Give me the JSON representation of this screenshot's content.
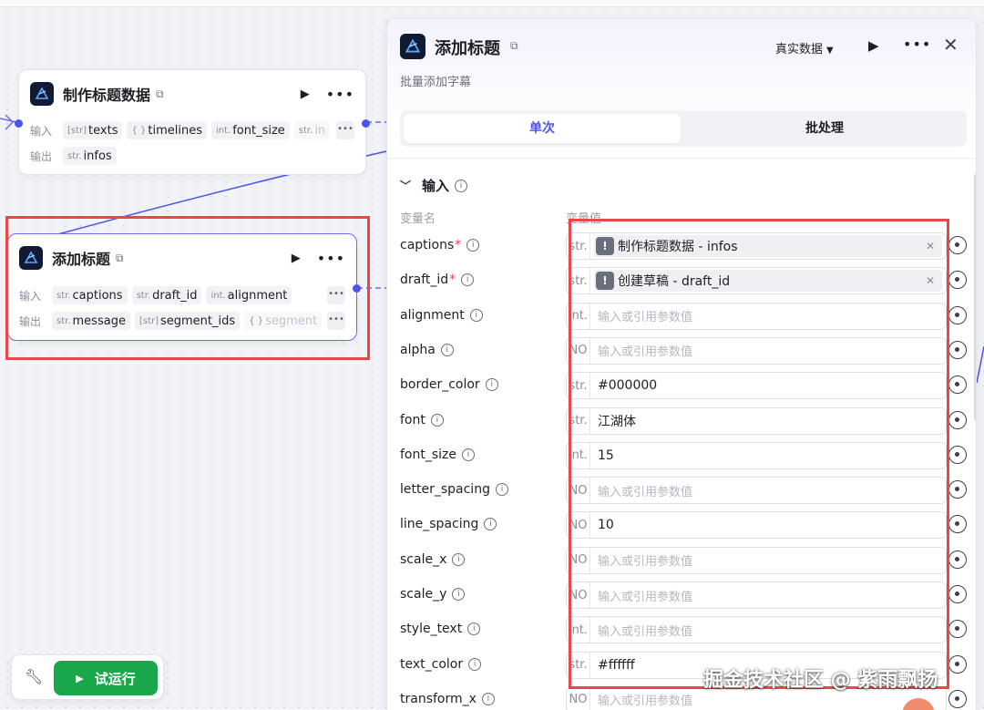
{
  "colors": {
    "accent": "#4d53e8",
    "run_green": "#1aa64a",
    "highlight_red": "#e84848"
  },
  "nodes": {
    "make_title": {
      "title": "制作标题数据",
      "input_label": "输入",
      "output_label": "输出",
      "inputs": [
        {
          "type": "[str]",
          "name": "texts"
        },
        {
          "type": "{ }",
          "name": "timelines"
        },
        {
          "type": "int.",
          "name": "font_size"
        },
        {
          "type": "str.",
          "name": "in"
        }
      ],
      "outputs": [
        {
          "type": "str.",
          "name": "infos"
        }
      ]
    },
    "add_title": {
      "title": "添加标题",
      "input_label": "输入",
      "output_label": "输出",
      "inputs": [
        {
          "type": "str.",
          "name": "captions"
        },
        {
          "type": "str.",
          "name": "draft_id"
        },
        {
          "type": "int.",
          "name": "alignment"
        }
      ],
      "outputs": [
        {
          "type": "str.",
          "name": "message"
        },
        {
          "type": "[str]",
          "name": "segment_ids"
        },
        {
          "type": "{ }",
          "name": "segment"
        }
      ]
    }
  },
  "toolbar": {
    "run_label": "试运行"
  },
  "panel": {
    "title": "添加标题",
    "description": "批量添加字幕",
    "mode": "真实数据",
    "tabs": [
      {
        "label": "单次",
        "active": true
      },
      {
        "label": "批处理",
        "active": false
      }
    ],
    "section_title": "输入",
    "col_name": "变量名",
    "col_value": "变量值",
    "fields": [
      {
        "name": "captions",
        "required": true,
        "type": "str.",
        "ref": true,
        "ref_text": "制作标题数据 - infos"
      },
      {
        "name": "draft_id",
        "required": true,
        "type": "str.",
        "ref": true,
        "ref_text": "创建草稿 - draft_id"
      },
      {
        "name": "alignment",
        "type": "int.",
        "value": "",
        "placeholder": "输入或引用参数值"
      },
      {
        "name": "alpha",
        "type": "NO",
        "value": "",
        "placeholder": "输入或引用参数值"
      },
      {
        "name": "border_color",
        "type": "str.",
        "value": "#000000"
      },
      {
        "name": "font",
        "type": "str.",
        "value": "江湖体"
      },
      {
        "name": "font_size",
        "type": "int.",
        "value": "15"
      },
      {
        "name": "letter_spacing",
        "type": "NO",
        "value": "",
        "placeholder": "输入或引用参数值"
      },
      {
        "name": "line_spacing",
        "type": "NO",
        "value": "10"
      },
      {
        "name": "scale_x",
        "type": "NO",
        "value": "",
        "placeholder": "输入或引用参数值"
      },
      {
        "name": "scale_y",
        "type": "NO",
        "value": "",
        "placeholder": "输入或引用参数值"
      },
      {
        "name": "style_text",
        "type": "int.",
        "value": "",
        "placeholder": "输入或引用参数值"
      },
      {
        "name": "text_color",
        "type": "str.",
        "value": "#ffffff"
      },
      {
        "name": "transform_x",
        "type": "NO",
        "value": "",
        "placeholder": "输入或引用参数值"
      }
    ]
  },
  "watermark": "掘金技术社区 @ 紫雨飘扬"
}
